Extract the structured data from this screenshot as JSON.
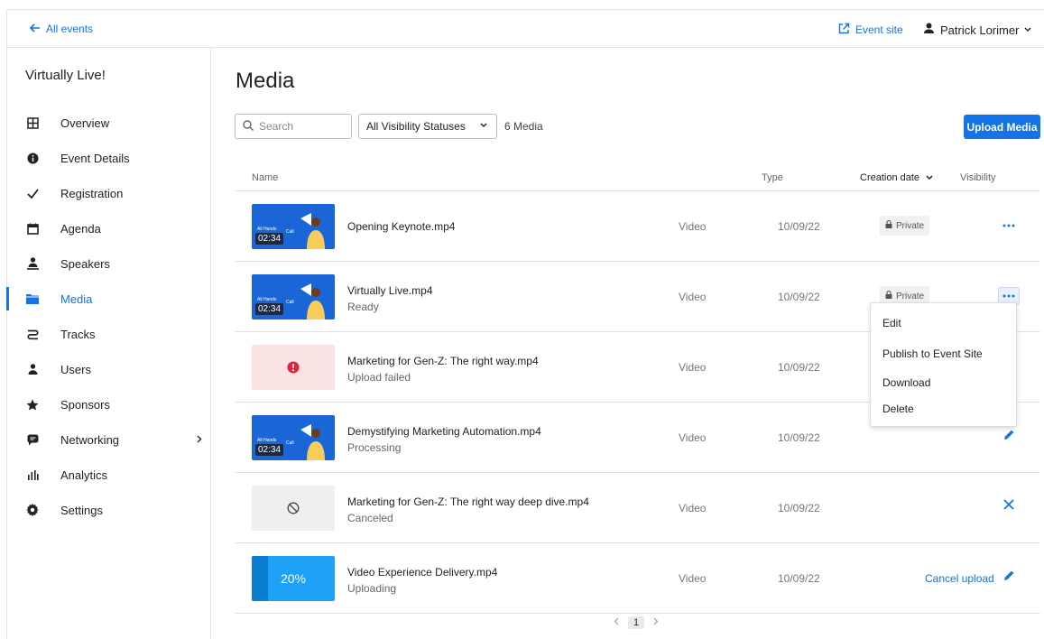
{
  "topbar": {
    "back_label": "All events",
    "event_site_label": "Event site",
    "user_name": "Patrick Lorimer"
  },
  "sidebar": {
    "event_name": "Virtually Live!",
    "items": [
      {
        "label": "Overview",
        "icon": "grid-icon"
      },
      {
        "label": "Event Details",
        "icon": "info-icon"
      },
      {
        "label": "Registration",
        "icon": "check-icon"
      },
      {
        "label": "Agenda",
        "icon": "calendar-icon"
      },
      {
        "label": "Speakers",
        "icon": "speaker-icon"
      },
      {
        "label": "Media",
        "icon": "folder-icon"
      },
      {
        "label": "Tracks",
        "icon": "tracks-icon"
      },
      {
        "label": "Users",
        "icon": "user-icon"
      },
      {
        "label": "Sponsors",
        "icon": "star-icon"
      },
      {
        "label": "Networking",
        "icon": "chat-icon"
      },
      {
        "label": "Analytics",
        "icon": "bar-chart-icon"
      },
      {
        "label": "Settings",
        "icon": "gear-icon"
      }
    ],
    "active": "Media"
  },
  "main": {
    "title": "Media",
    "search_placeholder": "Search",
    "visibility_filter": "All Visibility Statuses",
    "media_count": "6 Media",
    "upload_label": "Upload Media",
    "columns": {
      "name": "Name",
      "type": "Type",
      "creation_date": "Creation date",
      "visibility": "Visibility"
    },
    "rows": [
      {
        "name": "Opening Keynote.mp4",
        "status": "",
        "type": "Video",
        "date": "10/09/22",
        "visibility": "Private",
        "thumb": "video",
        "duration": "02:34",
        "action": "more"
      },
      {
        "name": "Virtually Live.mp4",
        "status": "Ready",
        "type": "Video",
        "date": "10/09/22",
        "visibility": "Private",
        "thumb": "video",
        "duration": "02:34",
        "action": "more-open"
      },
      {
        "name": "Marketing for Gen-Z: The right way.mp4",
        "status": "Upload failed",
        "type": "Video",
        "date": "10/09/22",
        "visibility": "",
        "thumb": "failed",
        "action": ""
      },
      {
        "name": "Demystifying Marketing Automation.mp4",
        "status": "Processing",
        "type": "Video",
        "date": "10/09/22",
        "visibility": "",
        "thumb": "video",
        "duration": "02:34",
        "action": "edit"
      },
      {
        "name": "Marketing for Gen-Z: The right way deep dive.mp4",
        "status": "Canceled",
        "type": "Video",
        "date": "10/09/22",
        "visibility": "",
        "thumb": "canceled",
        "action": "close"
      },
      {
        "name": "Video Experience Delivery.mp4",
        "status": "Uploading",
        "type": "Video",
        "date": "10/09/22",
        "visibility": "",
        "thumb": "uploading",
        "progress": 0.2,
        "progress_label": "20%",
        "cancel_label": "Cancel upload",
        "action": "edit"
      }
    ],
    "pagination": {
      "current": "1"
    }
  },
  "menu": {
    "items": [
      "Edit",
      "Publish to Event Site",
      "Download",
      "Delete"
    ]
  },
  "colors": {
    "accent": "#1473e6",
    "thumb_blue": "#1a66d6",
    "error_red": "#d7263d"
  }
}
